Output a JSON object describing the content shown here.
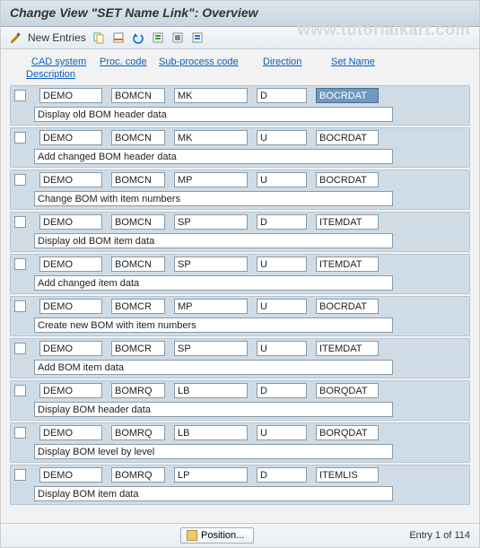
{
  "title": "Change View \"SET Name Link\": Overview",
  "toolbar": {
    "new_entries": "New Entries"
  },
  "watermark": "www.tutorialkart.com",
  "headers": {
    "cad": "CAD system",
    "proc": "Proc. code",
    "sub": "Sub-process code",
    "dir": "Direction",
    "set": "Set Name",
    "desc": "Description"
  },
  "rows": [
    {
      "cad": "DEMO",
      "proc": "BOMCN",
      "sub": "MK",
      "dir": "D",
      "set": "BOCRDAT",
      "set_sel": true,
      "desc": "Display old BOM header data"
    },
    {
      "cad": "DEMO",
      "proc": "BOMCN",
      "sub": "MK",
      "dir": "U",
      "set": "BOCRDAT",
      "desc": "Add changed BOM header data"
    },
    {
      "cad": "DEMO",
      "proc": "BOMCN",
      "sub": "MP",
      "dir": "U",
      "set": "BOCRDAT",
      "desc": "Change BOM with item numbers"
    },
    {
      "cad": "DEMO",
      "proc": "BOMCN",
      "sub": "SP",
      "dir": "D",
      "set": "ITEMDAT",
      "desc": "Display old BOM item data"
    },
    {
      "cad": "DEMO",
      "proc": "BOMCN",
      "sub": "SP",
      "dir": "U",
      "set": "ITEMDAT",
      "desc": "Add changed item data"
    },
    {
      "cad": "DEMO",
      "proc": "BOMCR",
      "sub": "MP",
      "dir": "U",
      "set": "BOCRDAT",
      "desc": "Create new BOM with item numbers"
    },
    {
      "cad": "DEMO",
      "proc": "BOMCR",
      "sub": "SP",
      "dir": "U",
      "set": "ITEMDAT",
      "desc": "Add BOM item data"
    },
    {
      "cad": "DEMO",
      "proc": "BOMRQ",
      "sub": "LB",
      "dir": "D",
      "set": "BORQDAT",
      "desc": "Display BOM header data"
    },
    {
      "cad": "DEMO",
      "proc": "BOMRQ",
      "sub": "LB",
      "dir": "U",
      "set": "BORQDAT",
      "desc": "Display BOM level by level"
    },
    {
      "cad": "DEMO",
      "proc": "BOMRQ",
      "sub": "LP",
      "dir": "D",
      "set": "ITEMLIS",
      "desc": "Display BOM item data"
    }
  ],
  "footer": {
    "position": "Position...",
    "entry": "Entry 1 of 114"
  }
}
